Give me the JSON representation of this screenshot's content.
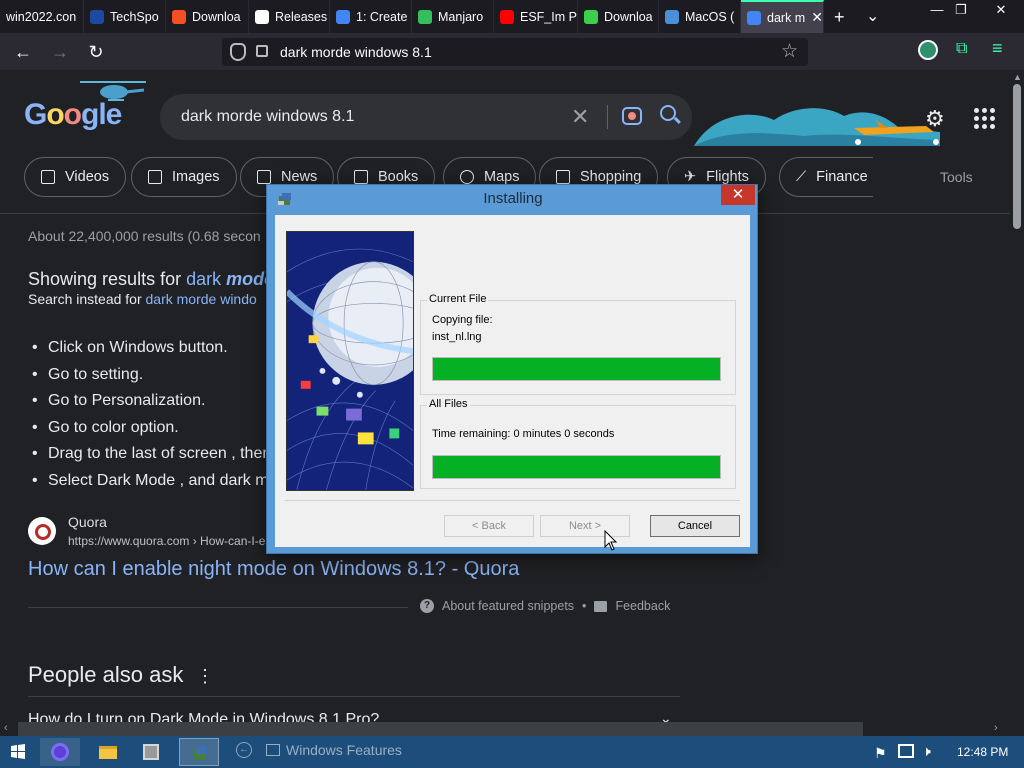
{
  "browser": {
    "tabs": [
      {
        "label": "win2022.con",
        "color": "#444"
      },
      {
        "label": "TechSpo",
        "color": "#1b4ba0"
      },
      {
        "label": "Downloa",
        "color": "#f25022"
      },
      {
        "label": "Releases",
        "color": "#ffffff"
      },
      {
        "label": "1: Create",
        "color": "#4285f4"
      },
      {
        "label": "Manjaro",
        "color": "#35bf5c"
      },
      {
        "label": "ESF_Im P",
        "color": "#ff0000"
      },
      {
        "label": "Downloa",
        "color": "#3ccf4e"
      },
      {
        "label": "MacOS (",
        "color": "#4a90d9"
      },
      {
        "label": "dark m",
        "color": "#4285f4"
      }
    ],
    "new_tab_glyph": "+",
    "list_tabs_glyph": "⌄",
    "window_controls": [
      "—",
      "❐",
      "✕"
    ],
    "url": "dark morde windows 8.1"
  },
  "google": {
    "logo": {
      "g1": "G",
      "o1": "o",
      "o2": "o",
      "gle": "gle"
    },
    "query": "dark morde windows 8.1",
    "chips": [
      "Videos",
      "Images",
      "News",
      "Books",
      "Maps",
      "Shopping",
      "Flights",
      "Finance"
    ],
    "tools": "Tools",
    "stats": "About 22,400,000 results (0.68 secon",
    "showing_prefix": "Showing results for ",
    "showing_link_a": "dark ",
    "showing_link_b": "mode",
    "instead_prefix": "Search instead for ",
    "instead_link": "dark morde windo",
    "bullets": [
      "Click on Windows button.",
      "Go to setting.",
      "Go to Personalization.",
      "Go to color option.",
      "Drag to the last of screen , then",
      "Select Dark Mode , and dark m"
    ],
    "source_name": "Quora",
    "source_url": "https://www.quora.com › How-can-I-e",
    "result_title": "How can I enable night mode on Windows 8.1? - Quora",
    "about_snippets": "About featured snippets",
    "feedback": "Feedback",
    "paa_title": "People also ask",
    "paa_question": "How do I turn on Dark Mode in Windows 8.1 Pro?"
  },
  "installer": {
    "title": "Installing",
    "current_file_group": "Current File",
    "copying_label": "Copying file:",
    "file_name": "inst_nl.lng",
    "current_progress": 1.0,
    "all_files_group": "All Files",
    "time_remaining": "Time remaining: 0 minutes 0 seconds",
    "all_progress": 1.0,
    "back_label": "< Back",
    "next_label": "Next >",
    "cancel_label": "Cancel"
  },
  "taskbar": {
    "windows_features": "Windows Features",
    "time": "12:48 PM"
  },
  "colors": {
    "accent_tab": "#3bffb0",
    "progress_green": "#06b025",
    "link_blue": "#8ab4f8",
    "close_red": "#c7362a"
  },
  "icons": [
    "search-icon",
    "camera-lens-icon",
    "clear-icon",
    "gear-icon",
    "apps-grid-icon",
    "shield-icon",
    "lock-icon",
    "star-icon",
    "back-icon",
    "forward-icon",
    "reload-icon"
  ]
}
